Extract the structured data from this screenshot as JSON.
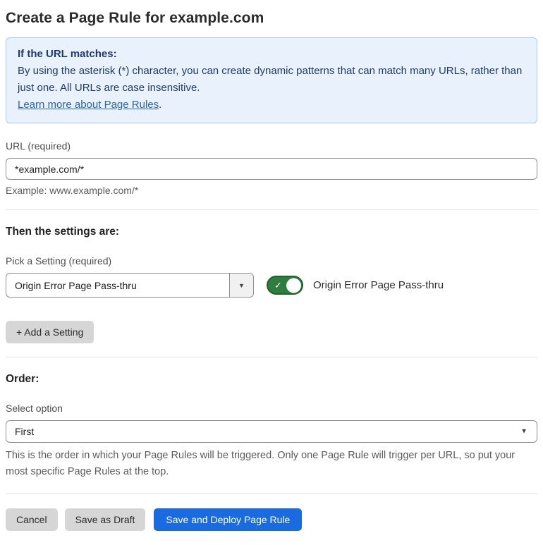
{
  "title": "Create a Page Rule for example.com",
  "info_box": {
    "heading": "If the URL matches:",
    "body": "By using the asterisk (*) character, you can create dynamic patterns that can match many URLs, rather than just one. All URLs are case insensitive.",
    "link_label": "Learn more about Page Rules",
    "link_suffix": "."
  },
  "url_field": {
    "label": "URL (required)",
    "value": "*example.com/*",
    "helper": "Example: www.example.com/*"
  },
  "settings_section": {
    "heading": "Then the settings are:",
    "picker_label": "Pick a Setting (required)",
    "picker_value": "Origin Error Page Pass-thru",
    "toggle_label": "Origin Error Page Pass-thru",
    "toggle_state": "on",
    "add_setting_label": "+ Add a Setting"
  },
  "order_section": {
    "heading": "Order:",
    "select_label": "Select option",
    "select_value": "First",
    "helper": "This is the order in which your Page Rules will be triggered. Only one Page Rule will trigger per URL, so put your most specific Page Rules at the top."
  },
  "footer": {
    "cancel_label": "Cancel",
    "save_draft_label": "Save as Draft",
    "save_deploy_label": "Save and Deploy Page Rule"
  },
  "icons": {
    "dropdown_caret": "▼",
    "check": "✓"
  },
  "colors": {
    "primary_blue": "#1a6be0",
    "toggle_green": "#2e7d3e",
    "info_background": "#e9f2fc",
    "info_border": "#a9c9ee",
    "info_text": "#1e3a6d",
    "link_blue": "#2b64ad"
  }
}
